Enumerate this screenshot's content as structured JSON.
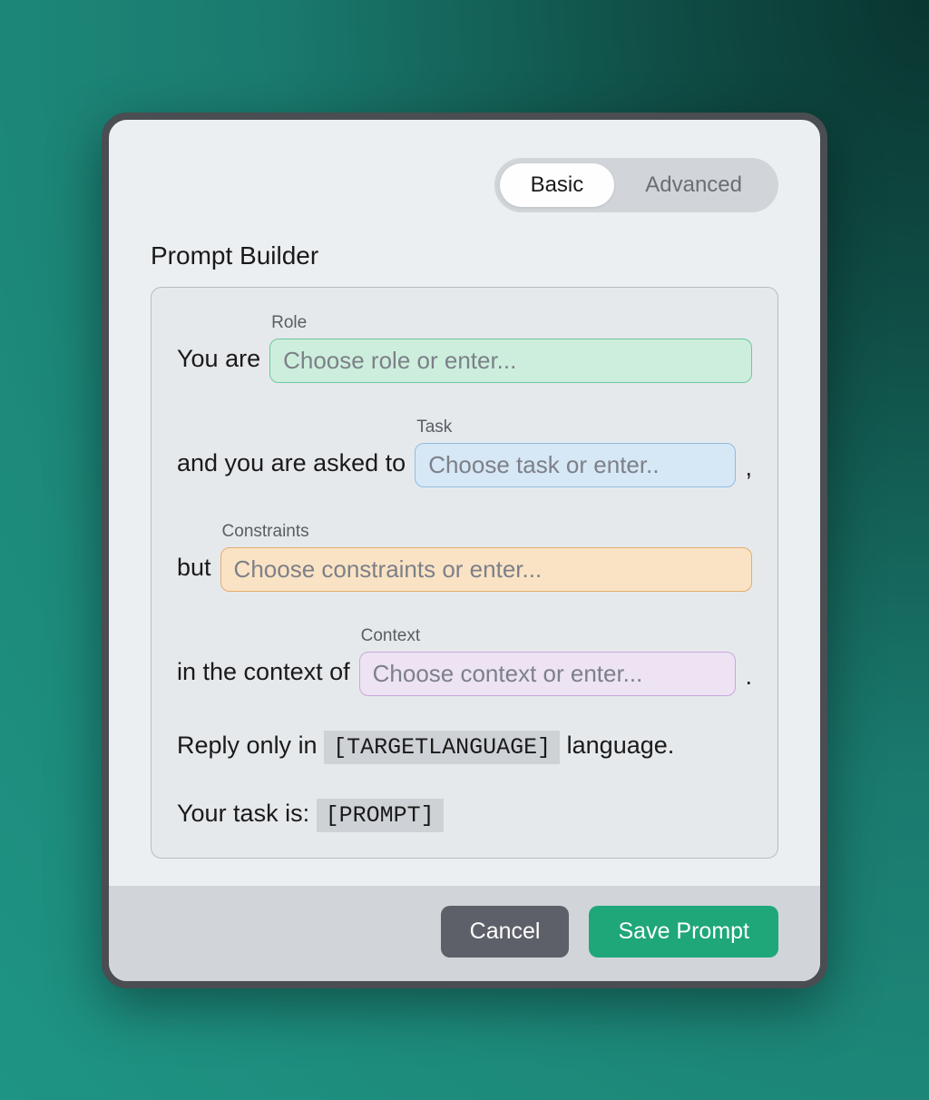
{
  "tabs": {
    "basic": "Basic",
    "advanced": "Advanced"
  },
  "title": "Prompt Builder",
  "fields": {
    "role": {
      "lead": "You are",
      "label": "Role",
      "placeholder": "Choose role or enter..."
    },
    "task": {
      "lead": "and you are asked to",
      "label": "Task",
      "placeholder": "Choose task or enter..",
      "trail": ","
    },
    "constraints": {
      "lead": "but",
      "label": "Constraints",
      "placeholder": "Choose constraints or enter..."
    },
    "context": {
      "lead": "in the context of",
      "label": "Context",
      "placeholder": "Choose context or enter...",
      "trail": "."
    }
  },
  "static": {
    "reply_pre": "Reply only in ",
    "reply_token": "[TARGETLANGUAGE]",
    "reply_post": " language.",
    "task_pre": "Your task is: ",
    "task_token": "[PROMPT]"
  },
  "buttons": {
    "cancel": "Cancel",
    "save": "Save Prompt"
  }
}
